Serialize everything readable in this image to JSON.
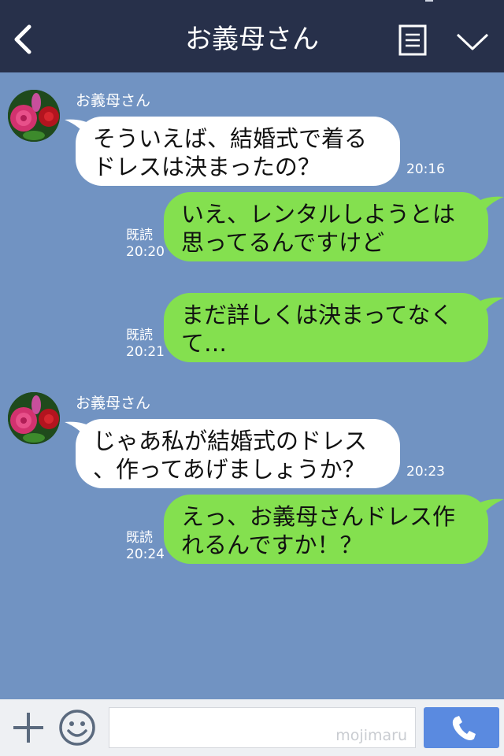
{
  "header": {
    "title": "お義母さん"
  },
  "messages": [
    {
      "direction": "in",
      "sender": "お義母さん",
      "line1": "そういえば、結婚式で着る",
      "line2": "ドレスは決まったの？",
      "time": "20:16"
    },
    {
      "direction": "out",
      "read": "既読",
      "line1": "いえ、レンタルしようとは",
      "line2": "思ってるんですけど",
      "time": "20:20"
    },
    {
      "direction": "out",
      "read": "既読",
      "line1": "まだ詳しくは決まってなく",
      "line2": "て…",
      "time": "20:21"
    },
    {
      "direction": "in",
      "sender": "お義母さん",
      "line1": "じゃあ私が結婚式のドレス",
      "line2": "、作ってあげましょうか？",
      "time": "20:23"
    },
    {
      "direction": "out",
      "read": "既読",
      "line1": "えっ、お義母さんドレス作",
      "line2": "れるんですか！？",
      "time": "20:24"
    }
  ],
  "footer": {
    "input_value": "",
    "watermark": "mojimaru"
  },
  "colors": {
    "header_bg": "#27304a",
    "chat_bg": "#7193c2",
    "incoming_bubble": "#ffffff",
    "outgoing_bubble": "#84e04f",
    "call_button": "#5a8ae0"
  },
  "icons": {
    "back": "chevron-left-icon",
    "notes": "note-icon",
    "menu": "chevron-down-icon",
    "plus": "plus-icon",
    "emoji": "smiley-icon",
    "call": "phone-icon"
  }
}
